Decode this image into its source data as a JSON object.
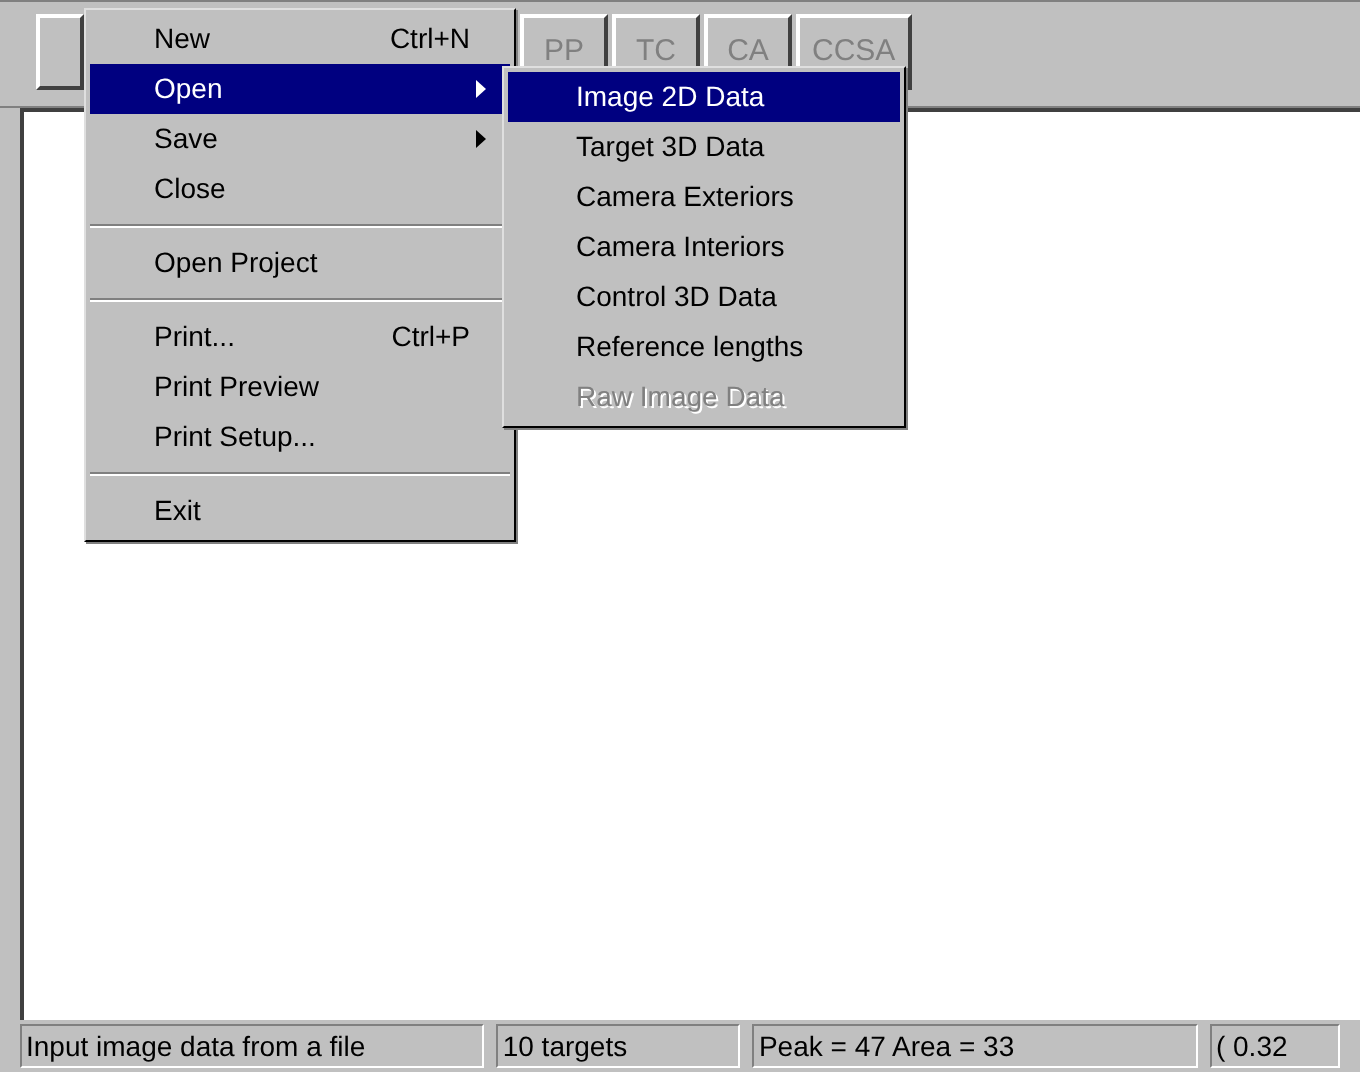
{
  "toolbar": {
    "buttons": [
      {
        "label": "PP",
        "disabled": true
      },
      {
        "label": "TC",
        "disabled": true
      },
      {
        "label": "CA",
        "disabled": true
      },
      {
        "label": "CCSA",
        "disabled": true
      }
    ]
  },
  "file_menu": {
    "items": [
      {
        "kind": "item",
        "label": "New",
        "shortcut": "Ctrl+N",
        "selected": false,
        "submenu": false
      },
      {
        "kind": "item",
        "label": "Open",
        "selected": true,
        "submenu": true
      },
      {
        "kind": "item",
        "label": "Save",
        "selected": false,
        "submenu": true
      },
      {
        "kind": "item",
        "label": "Close",
        "selected": false,
        "submenu": false
      },
      {
        "kind": "separator"
      },
      {
        "kind": "item",
        "label": "Open Project",
        "selected": false,
        "submenu": false
      },
      {
        "kind": "separator"
      },
      {
        "kind": "item",
        "label": "Print...",
        "shortcut": "Ctrl+P",
        "selected": false,
        "submenu": false
      },
      {
        "kind": "item",
        "label": "Print Preview",
        "selected": false,
        "submenu": false
      },
      {
        "kind": "item",
        "label": "Print Setup...",
        "selected": false,
        "submenu": false
      },
      {
        "kind": "separator"
      },
      {
        "kind": "item",
        "label": "Exit",
        "selected": false,
        "submenu": false
      }
    ]
  },
  "open_submenu": {
    "items": [
      {
        "label": "Image 2D Data",
        "selected": true,
        "disabled": false
      },
      {
        "label": "Target 3D Data",
        "selected": false,
        "disabled": false
      },
      {
        "label": "Camera Exteriors",
        "selected": false,
        "disabled": false
      },
      {
        "label": "Camera Interiors",
        "selected": false,
        "disabled": false
      },
      {
        "label": "Control 3D Data",
        "selected": false,
        "disabled": false
      },
      {
        "label": "Reference lengths",
        "selected": false,
        "disabled": false
      },
      {
        "label": "Raw Image Data",
        "selected": false,
        "disabled": true
      }
    ]
  },
  "status_bar": {
    "panes": [
      "Input image data from a file",
      "10 targets",
      "Peak =  47  Area = 33",
      "( 0.32"
    ]
  }
}
